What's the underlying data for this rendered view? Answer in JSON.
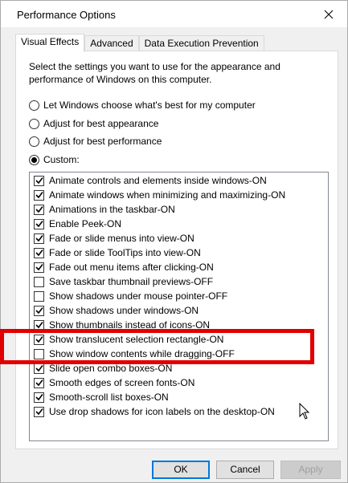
{
  "window": {
    "title": "Performance Options"
  },
  "tabs": [
    {
      "label": "Visual Effects",
      "active": true
    },
    {
      "label": "Advanced",
      "active": false
    },
    {
      "label": "Data Execution Prevention",
      "active": false
    }
  ],
  "description": "Select the settings you want to use for the appearance and performance of Windows on this computer.",
  "radios": [
    {
      "label": "Let Windows choose what's best for my computer",
      "checked": false
    },
    {
      "label": "Adjust for best appearance",
      "checked": false
    },
    {
      "label": "Adjust for best performance",
      "checked": false
    },
    {
      "label": "Custom:",
      "checked": true
    }
  ],
  "effects": [
    {
      "label": "Animate controls and elements inside windows-ON",
      "checked": true
    },
    {
      "label": "Animate windows when minimizing and maximizing-ON",
      "checked": true
    },
    {
      "label": "Animations in the taskbar-ON",
      "checked": true
    },
    {
      "label": "Enable Peek-ON",
      "checked": true
    },
    {
      "label": "Fade or slide menus into view-ON",
      "checked": true
    },
    {
      "label": "Fade or slide ToolTips into view-ON",
      "checked": true
    },
    {
      "label": "Fade out menu items after clicking-ON",
      "checked": true
    },
    {
      "label": "Save taskbar thumbnail previews-OFF",
      "checked": false
    },
    {
      "label": "Show shadows under mouse pointer-OFF",
      "checked": false
    },
    {
      "label": "Show shadows under windows-ON",
      "checked": true
    },
    {
      "label": "Show thumbnails instead of icons-ON",
      "checked": true
    },
    {
      "label": "Show translucent selection rectangle-ON",
      "checked": true
    },
    {
      "label": "Show window contents while dragging-OFF",
      "checked": false
    },
    {
      "label": "Slide open combo boxes-ON",
      "checked": true
    },
    {
      "label": "Smooth edges of screen fonts-ON",
      "checked": true
    },
    {
      "label": "Smooth-scroll list boxes-ON",
      "checked": true
    },
    {
      "label": "Use drop shadows for icon labels on the desktop-ON",
      "checked": true
    }
  ],
  "buttons": {
    "ok": "OK",
    "cancel": "Cancel",
    "apply": "Apply"
  },
  "colors": {
    "highlight": "#e00000",
    "default_button_border": "#0078d7"
  }
}
